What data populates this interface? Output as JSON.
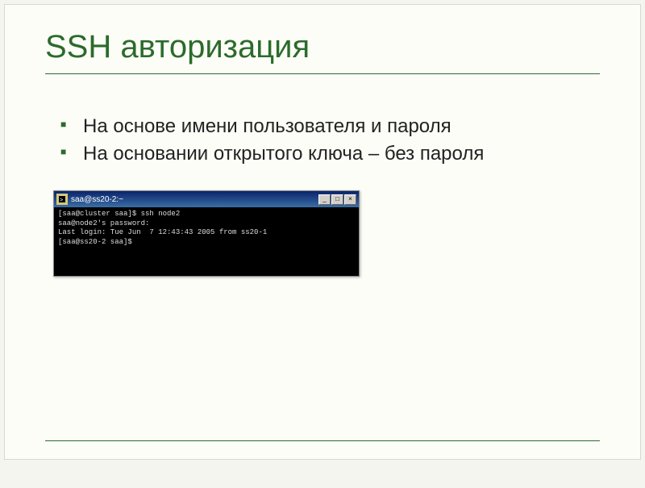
{
  "title": "SSH авторизация",
  "bullets": [
    "На основе имени пользователя и пароля",
    "На основании открытого ключа – без пароля"
  ],
  "terminal": {
    "titlebar_text": "saa@ss20-2:~",
    "lines": [
      "[saa@cluster saa]$ ssh node2",
      "saa@node2's password:",
      "Last login: Tue Jun  7 12:43:43 2005 from ss20-1",
      "[saa@ss20-2 saa]$"
    ]
  },
  "window_controls": {
    "minimize": "_",
    "maximize": "□",
    "close": "×"
  }
}
